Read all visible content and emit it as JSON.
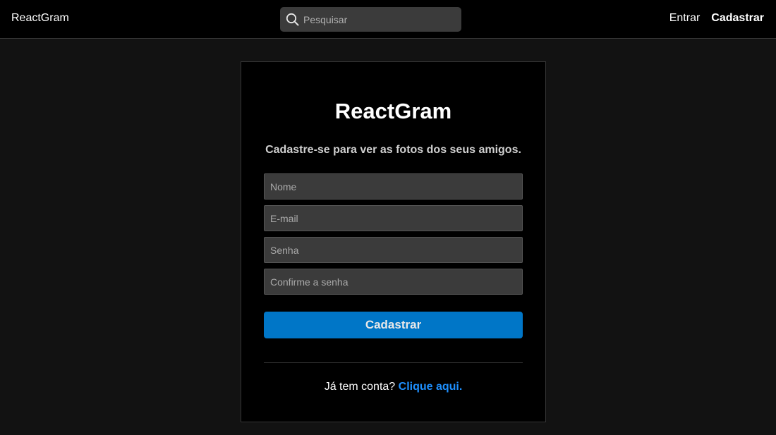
{
  "navbar": {
    "brand": "ReactGram",
    "search": {
      "placeholder": "Pesquisar",
      "value": "",
      "icon": "search-icon"
    },
    "links": {
      "login": "Entrar",
      "register": "Cadastrar"
    }
  },
  "register_form": {
    "title": "ReactGram",
    "subtitle": "Cadastre-se para ver as fotos dos seus amigos.",
    "fields": {
      "name": {
        "placeholder": "Nome",
        "value": ""
      },
      "email": {
        "placeholder": "E-mail",
        "value": ""
      },
      "password": {
        "placeholder": "Senha",
        "value": ""
      },
      "confirm_password": {
        "placeholder": "Confirme a senha",
        "value": ""
      }
    },
    "submit_label": "Cadastrar",
    "footer": {
      "prompt": "Já tem conta?",
      "link": "Clique aqui."
    }
  },
  "colors": {
    "background": "#121212",
    "navbar": "#000000",
    "card": "#000000",
    "input": "#3b3b3b",
    "primary_button": "#0076c7",
    "link": "#1e90ff"
  }
}
